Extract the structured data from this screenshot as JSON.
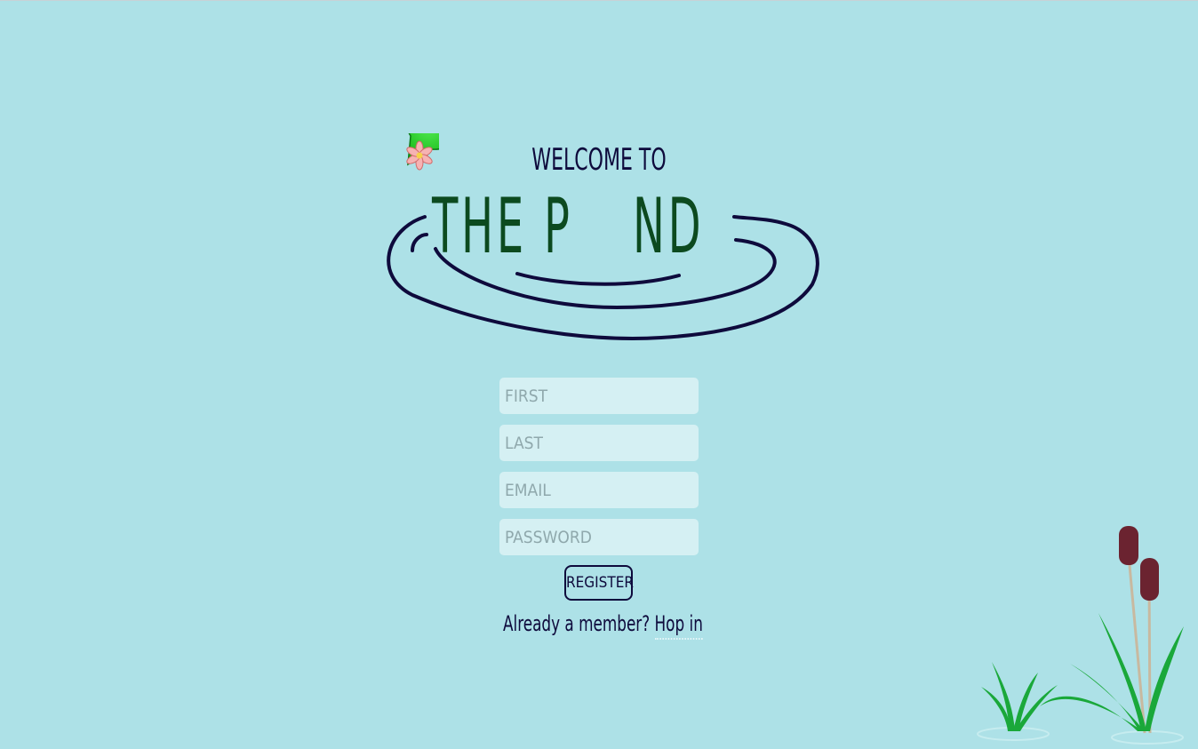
{
  "header": {
    "welcome": "WELCOME TO",
    "brand_the": "THE",
    "brand_p": "P",
    "brand_nd": "ND"
  },
  "form": {
    "first_placeholder": "FIRST",
    "last_placeholder": "LAST",
    "email_placeholder": "EMAIL",
    "password_placeholder": "PASSWORD",
    "register_label": "REGISTER"
  },
  "signin": {
    "prompt": "Already a member? ",
    "link": "Hop in"
  },
  "colors": {
    "background": "#ade1e7",
    "ink": "#0e0a3c",
    "brand_green": "#0c4a1f",
    "lily_pad": "#2bd62b",
    "cattail": "#6b2330",
    "reed": "#1aa83a"
  },
  "icons": [
    "ripple-lines",
    "lily-pad-icon",
    "lotus-flower-icon",
    "cattail-reeds-decoration"
  ]
}
